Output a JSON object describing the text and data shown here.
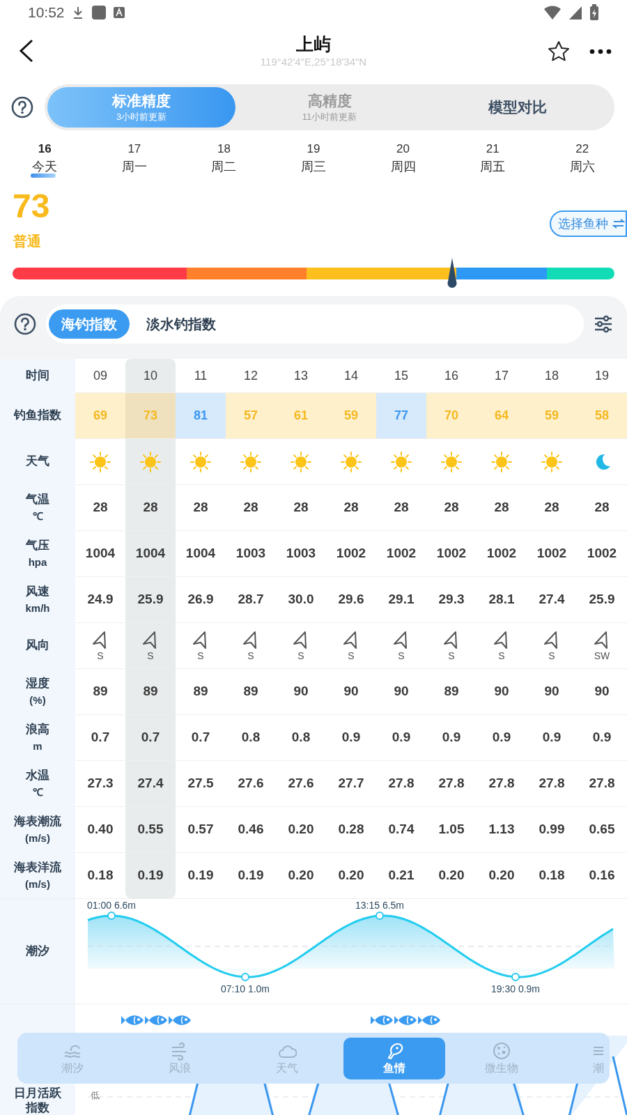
{
  "status_bar": {
    "time": "10:52"
  },
  "header": {
    "title": "上屿",
    "coordinates": "119°42'4\"E,25°18'34\"N"
  },
  "precision_tabs": [
    {
      "label": "标准精度",
      "subtitle": "3小时前更新",
      "selected": true
    },
    {
      "label": "高精度",
      "subtitle": "11小时前更新",
      "selected": false
    },
    {
      "label": "模型对比",
      "selected": false
    }
  ],
  "days": [
    {
      "date": "16",
      "weekday": "今天",
      "selected": true
    },
    {
      "date": "17",
      "weekday": "周一",
      "selected": false
    },
    {
      "date": "18",
      "weekday": "周二",
      "selected": false
    },
    {
      "date": "19",
      "weekday": "周三",
      "selected": false
    },
    {
      "date": "20",
      "weekday": "周四",
      "selected": false
    },
    {
      "date": "21",
      "weekday": "周五",
      "selected": false
    },
    {
      "date": "22",
      "weekday": "周六",
      "selected": false
    }
  ],
  "score": {
    "value": "73",
    "rating": "普通",
    "level": 0.73
  },
  "select_fish_button": "选择鱼种",
  "index_tabs": [
    {
      "label": "海钓指数",
      "selected": true
    },
    {
      "label": "淡水钓指数",
      "selected": false
    }
  ],
  "table": {
    "time_label": "时间",
    "columns": [
      {
        "hour": "09",
        "selected": false
      },
      {
        "hour": "10",
        "selected": true
      },
      {
        "hour": "11",
        "selected": false
      },
      {
        "hour": "12",
        "selected": false
      },
      {
        "hour": "13",
        "selected": false
      },
      {
        "hour": "14",
        "selected": false
      },
      {
        "hour": "15",
        "selected": false
      },
      {
        "hour": "16",
        "selected": false
      },
      {
        "hour": "17",
        "selected": false
      },
      {
        "hour": "18",
        "selected": false
      },
      {
        "hour": "19",
        "selected": false
      }
    ],
    "rows": [
      {
        "kind": "index",
        "label": "钓鱼指数",
        "cells": [
          {
            "value": "69",
            "kind": "normal"
          },
          {
            "value": "73",
            "kind": "normal"
          },
          {
            "value": "81",
            "kind": "good"
          },
          {
            "value": "57",
            "kind": "normal"
          },
          {
            "value": "61",
            "kind": "normal"
          },
          {
            "value": "59",
            "kind": "normal"
          },
          {
            "value": "77",
            "kind": "good"
          },
          {
            "value": "70",
            "kind": "normal"
          },
          {
            "value": "64",
            "kind": "normal"
          },
          {
            "value": "59",
            "kind": "normal"
          },
          {
            "value": "58",
            "kind": "normal"
          }
        ]
      },
      {
        "kind": "weather",
        "label": "天气",
        "cells": [
          {
            "kind": "sun"
          },
          {
            "kind": "sun"
          },
          {
            "kind": "sun"
          },
          {
            "kind": "sun"
          },
          {
            "kind": "sun"
          },
          {
            "kind": "sun"
          },
          {
            "kind": "sun"
          },
          {
            "kind": "sun"
          },
          {
            "kind": "sun"
          },
          {
            "kind": "sun"
          },
          {
            "kind": "moon"
          }
        ]
      },
      {
        "kind": "number",
        "label": "气温",
        "unit": "℃",
        "cells": [
          "28",
          "28",
          "28",
          "28",
          "28",
          "28",
          "28",
          "28",
          "28",
          "28",
          "28"
        ]
      },
      {
        "kind": "number",
        "label": "气压",
        "unit": "hpa",
        "cells": [
          "1004",
          "1004",
          "1004",
          "1003",
          "1003",
          "1002",
          "1002",
          "1002",
          "1002",
          "1002",
          "1002"
        ]
      },
      {
        "kind": "number",
        "label": "风速",
        "unit": "km/h",
        "cells": [
          "24.9",
          "25.9",
          "26.9",
          "28.7",
          "30.0",
          "29.6",
          "29.1",
          "29.3",
          "28.1",
          "27.4",
          "25.9"
        ]
      },
      {
        "kind": "wind",
        "label": "风向",
        "cells": [
          "S",
          "S",
          "S",
          "S",
          "S",
          "S",
          "S",
          "S",
          "S",
          "S",
          "SW"
        ]
      },
      {
        "kind": "number",
        "label": "湿度",
        "unit": "(%)",
        "cells": [
          "89",
          "89",
          "89",
          "89",
          "90",
          "90",
          "90",
          "89",
          "90",
          "90",
          "90"
        ]
      },
      {
        "kind": "number",
        "label": "浪高",
        "unit": "m",
        "cells": [
          "0.7",
          "0.7",
          "0.7",
          "0.8",
          "0.8",
          "0.9",
          "0.9",
          "0.9",
          "0.9",
          "0.9",
          "0.9"
        ]
      },
      {
        "kind": "number",
        "label": "水温",
        "unit": "℃",
        "cells": [
          "27.3",
          "27.4",
          "27.5",
          "27.6",
          "27.6",
          "27.7",
          "27.8",
          "27.8",
          "27.8",
          "27.8",
          "27.8"
        ]
      },
      {
        "kind": "number",
        "label": "海表潮流",
        "unit": "(m/s)",
        "cells": [
          "0.40",
          "0.55",
          "0.57",
          "0.46",
          "0.20",
          "0.28",
          "0.74",
          "1.05",
          "1.13",
          "0.99",
          "0.65"
        ]
      },
      {
        "kind": "number",
        "label": "海表洋流",
        "unit": "(m/s)",
        "cells": [
          "0.18",
          "0.19",
          "0.19",
          "0.19",
          "0.20",
          "0.20",
          "0.21",
          "0.20",
          "0.20",
          "0.18",
          "0.16"
        ]
      }
    ]
  },
  "tide": {
    "label": "潮汐",
    "points": [
      {
        "text": "01:00 6.6m",
        "kind": "high"
      },
      {
        "text": "07:10 1.0m",
        "kind": "low"
      },
      {
        "text": "13:15 6.5m",
        "kind": "high"
      },
      {
        "text": "19:30 0.9m",
        "kind": "low"
      }
    ]
  },
  "activity": {
    "label": "日月活跃指数",
    "axis_label": "低"
  },
  "bottom_nav": [
    {
      "label": "潮汐",
      "kind": "tide",
      "selected": false,
      "clipped": false
    },
    {
      "label": "风浪",
      "kind": "wind",
      "selected": false,
      "clipped": false
    },
    {
      "label": "天气",
      "kind": "weather",
      "selected": false,
      "clipped": false
    },
    {
      "label": "鱼情",
      "kind": "fish",
      "selected": true,
      "clipped": false
    },
    {
      "label": "微生物",
      "kind": "microbe",
      "selected": false,
      "clipped": false
    },
    {
      "label": "潮",
      "kind": "more",
      "selected": false,
      "clipped": true
    }
  ]
}
